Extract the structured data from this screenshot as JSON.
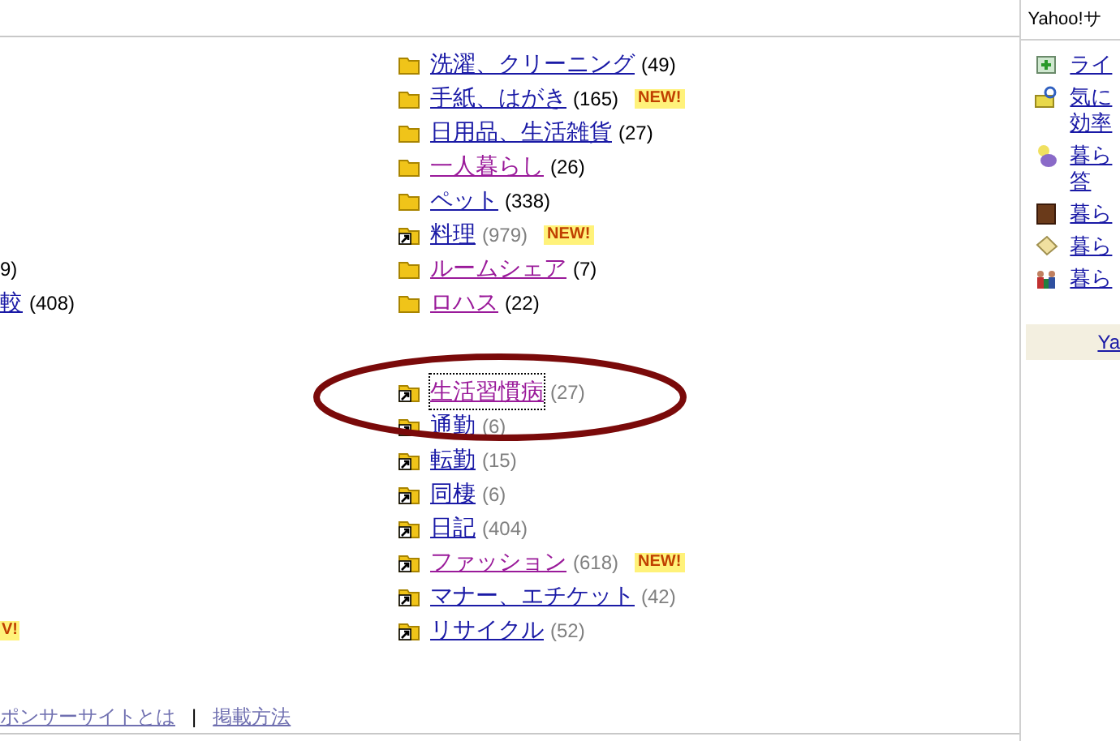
{
  "groups": [
    {
      "left": [
        {
          "kind": "count",
          "count": "9)"
        },
        {
          "kind": "link",
          "label": "較",
          "count": "(408)"
        }
      ],
      "items": [
        {
          "kind": "folder",
          "label": "洗濯、クリーニング",
          "count": "(49)",
          "visited": false
        },
        {
          "kind": "folder",
          "label": "手紙、はがき",
          "count": "(165)",
          "visited": false,
          "badge": "NEW!"
        },
        {
          "kind": "folder",
          "label": "日用品、生活雑貨",
          "count": "(27)",
          "visited": false
        },
        {
          "kind": "folder",
          "label": "一人暮らし",
          "count": "(26)",
          "visited": true
        },
        {
          "kind": "folder",
          "label": "ペット",
          "count": "(338)",
          "visited": false
        },
        {
          "kind": "shortcut",
          "label": "料理",
          "count": "(979)",
          "visited": false,
          "badge": "NEW!"
        },
        {
          "kind": "folder",
          "label": "ルームシェア",
          "count": "(7)",
          "visited": true
        },
        {
          "kind": "folder",
          "label": "ロハス",
          "count": "(22)",
          "visited": true
        }
      ]
    },
    {
      "left": [
        {
          "kind": "badge",
          "label": "V!"
        }
      ],
      "items": [
        {
          "kind": "shortcut",
          "label": "生活習慣病",
          "count": "(27)",
          "visited": true,
          "focused": true
        },
        {
          "kind": "shortcut",
          "label": "通勤",
          "count": "(6)",
          "visited": false
        },
        {
          "kind": "shortcut",
          "label": "転勤",
          "count": "(15)",
          "visited": false
        },
        {
          "kind": "shortcut",
          "label": "同棲",
          "count": "(6)",
          "visited": false
        },
        {
          "kind": "shortcut",
          "label": "日記",
          "count": "(404)",
          "visited": false
        },
        {
          "kind": "shortcut",
          "label": "ファッション",
          "count": "(618)",
          "visited": true,
          "badge": "NEW!"
        },
        {
          "kind": "shortcut",
          "label": "マナー、エチケット",
          "count": "(42)",
          "visited": false
        },
        {
          "kind": "shortcut",
          "label": "リサイクル",
          "count": "(52)",
          "visited": false
        }
      ]
    }
  ],
  "footer": {
    "links": [
      "ポンサーサイトとは",
      "掲載方法"
    ],
    "separator": "|"
  },
  "sidebar": {
    "title": "Yahoo!サ",
    "items": [
      {
        "lines": [
          "ライ"
        ]
      },
      {
        "lines": [
          "気に",
          "効率"
        ]
      },
      {
        "lines": [
          "暮ら",
          "答"
        ]
      },
      {
        "lines": [
          "暮ら"
        ]
      },
      {
        "lines": [
          "暮ら"
        ]
      },
      {
        "lines": [
          "暮ら"
        ]
      }
    ],
    "footer": "Ya"
  }
}
